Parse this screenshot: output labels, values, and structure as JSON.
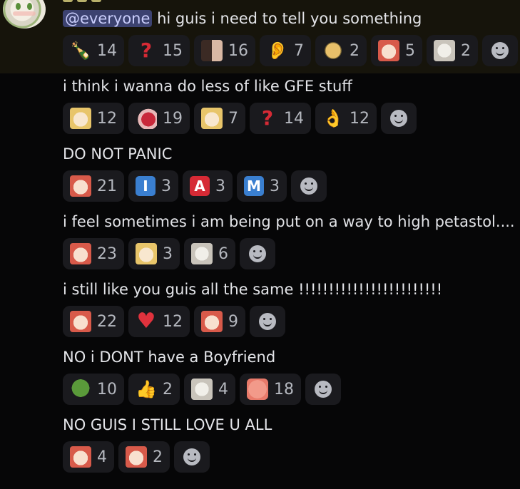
{
  "messages": [
    {
      "id": "m1",
      "text": "hi guis i need to tell you something",
      "mention": "@everyone",
      "reactions": [
        {
          "icon": "wine-bottle-icon",
          "count": "14"
        },
        {
          "icon": "red-question-mark-icon",
          "count": "15"
        },
        {
          "icon": "dark-anime-face-emoji-icon",
          "count": "16"
        },
        {
          "icon": "ear-icon",
          "count": "7"
        },
        {
          "icon": "lizard-emoji-icon",
          "count": "2"
        },
        {
          "icon": "anime-girl-emoji-icon",
          "count": "5"
        },
        {
          "icon": "anime-glasses-emoji-icon",
          "count": "2"
        }
      ]
    },
    {
      "id": "m2",
      "text": "i think i wanna do less of like GFE stuff",
      "reactions": [
        {
          "icon": "anime-shocked-emoji-icon",
          "count": "12"
        },
        {
          "icon": "hand-holding-emoji-icon",
          "count": "19"
        },
        {
          "icon": "anime-crying-emoji-icon",
          "count": "7"
        },
        {
          "icon": "red-question-mark-icon",
          "count": "14"
        },
        {
          "icon": "ok-hand-icon",
          "count": "12"
        }
      ]
    },
    {
      "id": "m3",
      "text": "DO NOT PANIC",
      "reactions": [
        {
          "icon": "anime-heart-emoji-icon",
          "count": "21"
        },
        {
          "icon": "regional-indicator-i-icon",
          "count": "3",
          "glyph": "I"
        },
        {
          "icon": "regional-indicator-a-icon",
          "count": "3",
          "glyph": "A"
        },
        {
          "icon": "regional-indicator-m-icon",
          "count": "3",
          "glyph": "M"
        }
      ]
    },
    {
      "id": "m4",
      "text": "i feel sometimes i am being put on a way to high petastol....",
      "reactions": [
        {
          "icon": "anime-blush-emoji-icon",
          "count": "23"
        },
        {
          "icon": "anime-sleepy-emoji-icon",
          "count": "3"
        },
        {
          "icon": "anime-wink-emoji-icon",
          "count": "6"
        }
      ]
    },
    {
      "id": "m5",
      "text": "i still like you guis all the same !!!!!!!!!!!!!!!!!!!!!!!!",
      "reactions": [
        {
          "icon": "anime-heart-emoji-icon",
          "count": "22"
        },
        {
          "icon": "red-heart-icon",
          "count": "12"
        },
        {
          "icon": "anime-blush-emoji-icon",
          "count": "9"
        }
      ]
    },
    {
      "id": "m6",
      "text": "NO i DONT  have a Boyfriend",
      "reactions": [
        {
          "icon": "pepe-emoji-icon",
          "count": "10"
        },
        {
          "icon": "thumbs-up-icon",
          "count": "2"
        },
        {
          "icon": "pale-anime-emoji-icon",
          "count": "4"
        },
        {
          "icon": "pink-blob-emoji-icon",
          "count": "18"
        }
      ]
    },
    {
      "id": "m7",
      "text": "NO GUIS I STILL LOVE U ALL",
      "reactions": [
        {
          "icon": "anime-heart-emoji-icon",
          "count": "4"
        },
        {
          "icon": "anime-laughing-emoji-icon",
          "count": "2"
        }
      ]
    }
  ],
  "colors": {
    "background": "#060607",
    "highlight": "#16140b",
    "mention_bg": "#3c4270",
    "mention_text": "#c9cdfb",
    "reaction_bg": "#1a1a1e"
  }
}
